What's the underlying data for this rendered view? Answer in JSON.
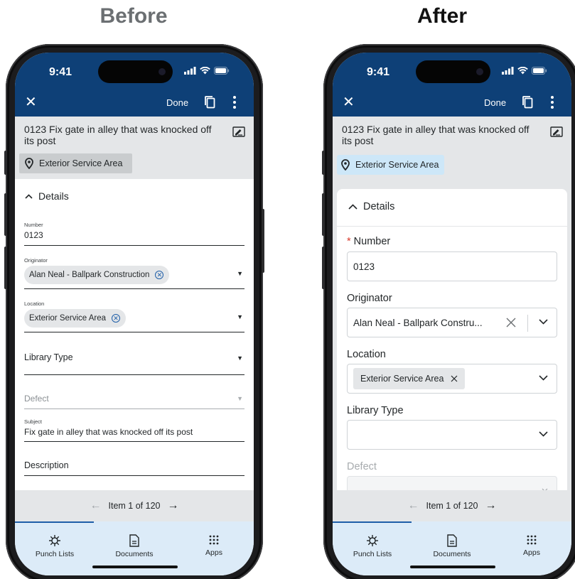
{
  "headings": {
    "before": "Before",
    "after": "After"
  },
  "status": {
    "time": "9:41"
  },
  "topbar": {
    "done": "Done"
  },
  "item": {
    "title": "0123 Fix gate in alley that was knocked off its post",
    "location_chip": "Exterior Service Area"
  },
  "details": {
    "toggle_label": "Details"
  },
  "before_form": {
    "number_label": "Number",
    "number_value": "0123",
    "originator_label": "Originator",
    "originator_value": "Alan Neal - Ballpark Construction",
    "location_label": "Location",
    "location_value": "Exterior Service Area",
    "library_type_label": "Library Type",
    "defect_label": "Defect",
    "subject_label": "Subject",
    "subject_value": "Fix gate in alley that was knocked off its post",
    "description_label": "Description"
  },
  "after_form": {
    "required_mark": "*",
    "number_label": "Number",
    "number_value": "0123",
    "originator_label": "Originator",
    "originator_value": "Alan Neal - Ballpark Constru...",
    "location_label": "Location",
    "location_value": "Exterior Service Area",
    "library_type_label": "Library Type",
    "defect_label": "Defect"
  },
  "pager": {
    "label": "Item 1 of 120"
  },
  "tabs": [
    {
      "label": "Punch Lists",
      "icon": "punch-list-icon"
    },
    {
      "label": "Documents",
      "icon": "document-icon"
    },
    {
      "label": "Apps",
      "icon": "apps-grid-icon"
    }
  ],
  "colors": {
    "header": "#0e4077",
    "tabbar": "#dcebf8",
    "location_chip_after": "#cde7f8",
    "required": "#d83a2b"
  }
}
